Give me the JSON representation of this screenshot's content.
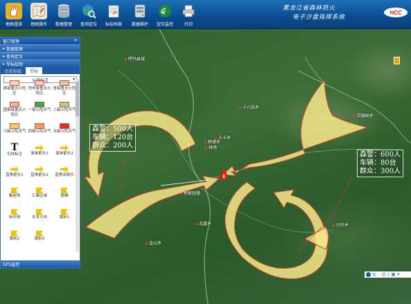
{
  "toolbar": {
    "items": [
      {
        "label": "地图漫游",
        "icon": "hand-icon",
        "color": "#e6b030"
      },
      {
        "label": "地图操作",
        "icon": "map-edit-icon",
        "color": "#5fa0d8"
      },
      {
        "label": "数据管理",
        "icon": "database-icon",
        "color": "#9aa7b5"
      },
      {
        "label": "查询定位",
        "icon": "globe-search-icon",
        "color": "#3aa84a"
      },
      {
        "label": "标绘档案",
        "icon": "document-icon",
        "color": "#e8e8e8"
      },
      {
        "label": "数据维护",
        "icon": "server-icon",
        "color": "#d0d8e0"
      },
      {
        "label": "定位监控",
        "icon": "satellite-icon",
        "color": "#2fa845"
      },
      {
        "label": "打印",
        "icon": "printer-icon",
        "color": "#d8d8d8"
      }
    ]
  },
  "system_title": {
    "line1": "黑龙江省森林防火",
    "line2": "电子沙盘指挥系统"
  },
  "logo_text": "HCC",
  "panel": {
    "title": "窗口管理",
    "close": "×",
    "menu": [
      "数据管理",
      "查询定位",
      "军标绘制"
    ],
    "tabs": [
      "历史标绘",
      "军标"
    ],
    "active_tab": 1,
    "dropdown_value": "火场标注",
    "symbols": [
      {
        "label": "县级重点火险区",
        "kind": "swatch",
        "color": "#f4d4c8"
      },
      {
        "label": "地市级重点火险区",
        "kind": "swatch",
        "color": "#eccfc0"
      },
      {
        "label": "省级重点火险区",
        "kind": "swatch",
        "color": "#d8c8a0"
      },
      {
        "label": "国家级重点火险区",
        "kind": "swatch",
        "color": "#f0b0a8"
      },
      {
        "label": "一级火险天气",
        "kind": "swatch",
        "color": "#2bb04a"
      },
      {
        "label": "二级火险天气",
        "kind": "swatch",
        "color": "#b8cc80"
      },
      {
        "label": "三级火险天气",
        "kind": "swatch",
        "color": "#f0d060"
      },
      {
        "label": "四级火险天气",
        "kind": "swatch",
        "color": "#f0a060"
      },
      {
        "label": "五级火险天气",
        "kind": "swatch",
        "color": "#e03020"
      },
      {
        "label": "引线标注",
        "kind": "text-t"
      },
      {
        "label": "简单箭头1",
        "kind": "arrow"
      },
      {
        "label": "简单箭头2",
        "kind": "arrow"
      },
      {
        "label": "直角箭头1",
        "kind": "arrow"
      },
      {
        "label": "直角箭头2",
        "kind": "arrow"
      },
      {
        "label": "直角双箭头",
        "kind": "arrow"
      },
      {
        "label": "集结地",
        "kind": "flag"
      },
      {
        "label": "汇聚区域",
        "kind": "flag"
      },
      {
        "label": "圈梯",
        "kind": "flag"
      },
      {
        "label": "标兵线",
        "kind": "flag"
      },
      {
        "label": "水流方向",
        "kind": "flag"
      },
      {
        "label": "旗标1",
        "kind": "flag"
      },
      {
        "label": "旗标2",
        "kind": "flag"
      },
      {
        "label": "旗标3",
        "kind": "flag"
      }
    ],
    "gps_label": "GPS监控"
  },
  "map": {
    "places": [
      "呼玛县城",
      "十八站乡",
      "白银纳乡",
      "三卡乡",
      "鸥浦乡",
      "韩家园镇",
      "北疆乡",
      "金山乡",
      "兴华乡",
      "林场"
    ],
    "box_left": {
      "lines": [
        "森警：500人",
        "车辆：120台",
        "群众：200人"
      ]
    },
    "box_right": {
      "lines": [
        "森警：600人",
        "车辆：80台",
        "群众：300人"
      ]
    },
    "fire_icon": "fire-icon"
  },
  "ime": {
    "text": "中"
  },
  "colors": {
    "arrow_fill": "#f6e88a",
    "arrow_stroke": "#d04030",
    "toolbar": "#0b4f95"
  }
}
